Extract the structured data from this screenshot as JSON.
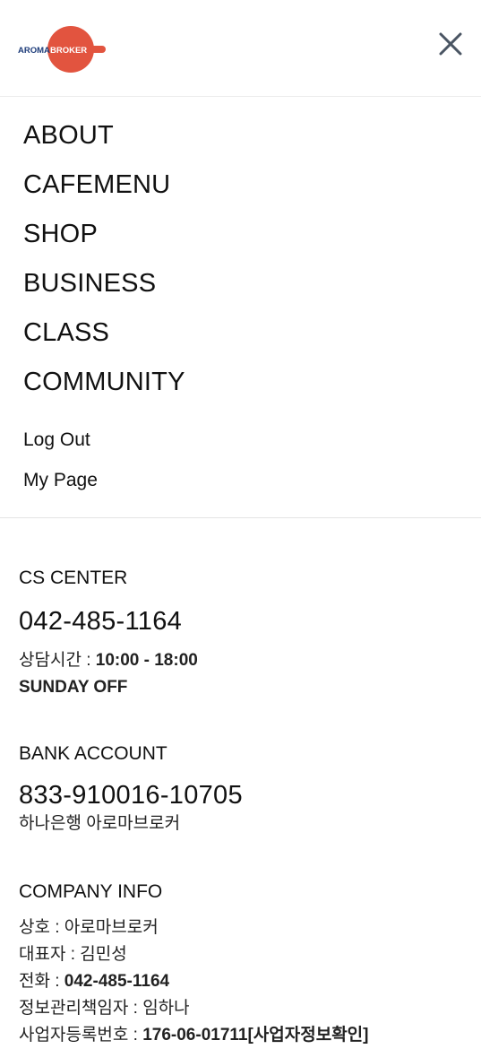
{
  "header": {
    "logo": {
      "left_text": "AROMA",
      "right_text": "BROKER",
      "badge_color": "#e2543f",
      "text_color": "#1d3c7a"
    },
    "close_icon": "close-icon"
  },
  "menu": {
    "items": [
      {
        "label": "ABOUT"
      },
      {
        "label": "CAFEMENU"
      },
      {
        "label": "SHOP"
      },
      {
        "label": "BUSINESS"
      },
      {
        "label": "CLASS"
      },
      {
        "label": "COMMUNITY"
      }
    ],
    "sub_items": [
      {
        "label": "Log Out"
      },
      {
        "label": "My Page"
      }
    ]
  },
  "cs_center": {
    "title": "CS CENTER",
    "phone": "042-485-1164",
    "hours_label": "상담시간 : ",
    "hours_value": "10:00 - 18:00",
    "off_day": "SUNDAY OFF"
  },
  "bank_account": {
    "title": "BANK ACCOUNT",
    "number": "833-910016-10705",
    "bank_name": "하나은행 아로마브로커"
  },
  "company_info": {
    "title": "COMPANY INFO",
    "lines": [
      {
        "label": "상호 : ",
        "value": "아로마브로커",
        "value_bold": false
      },
      {
        "label": "대표자 : ",
        "value": "김민성",
        "value_bold": false
      },
      {
        "label": "전화 : ",
        "value": "042-485-1164",
        "value_bold": true
      },
      {
        "label": "정보관리책임자 : ",
        "value": "임하나",
        "value_bold": false
      },
      {
        "label": "사업자등록번호 : ",
        "value": "176-06-01711[사업자정보확인]",
        "value_bold": true
      }
    ]
  }
}
